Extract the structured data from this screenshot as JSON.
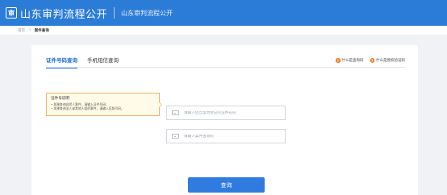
{
  "header": {
    "logo_glyph": "审",
    "title": "山东审判流程公开",
    "subtitle": "山东审判流程公开"
  },
  "breadcrumb": {
    "home": "首页",
    "separator": ">",
    "current": "案件查询"
  },
  "tabs": [
    {
      "label": "证件号码查询",
      "active": true
    },
    {
      "label": "手机短信查询",
      "active": false
    }
  ],
  "help_links": [
    {
      "icon": "question-icon",
      "label": "什么是查询码"
    },
    {
      "icon": "question-icon",
      "label": "什么是授权验证码"
    }
  ],
  "tip": {
    "title": "证件号说明",
    "items": [
      "如果查询自然人案件，请输入证件号码；",
      "如果查询法人或其他人组织案件，请输入证照号码。"
    ]
  },
  "form": {
    "id_placeholder": "请输入您立案时登记的证件号码",
    "case_code_placeholder": "请输入案件查询码",
    "query_label": "查询"
  },
  "colors": {
    "header_bg": "#2b7cd6",
    "accent": "#1e6fd9",
    "help_icon": "#ef7b22",
    "tip_border": "#f2b66a"
  }
}
